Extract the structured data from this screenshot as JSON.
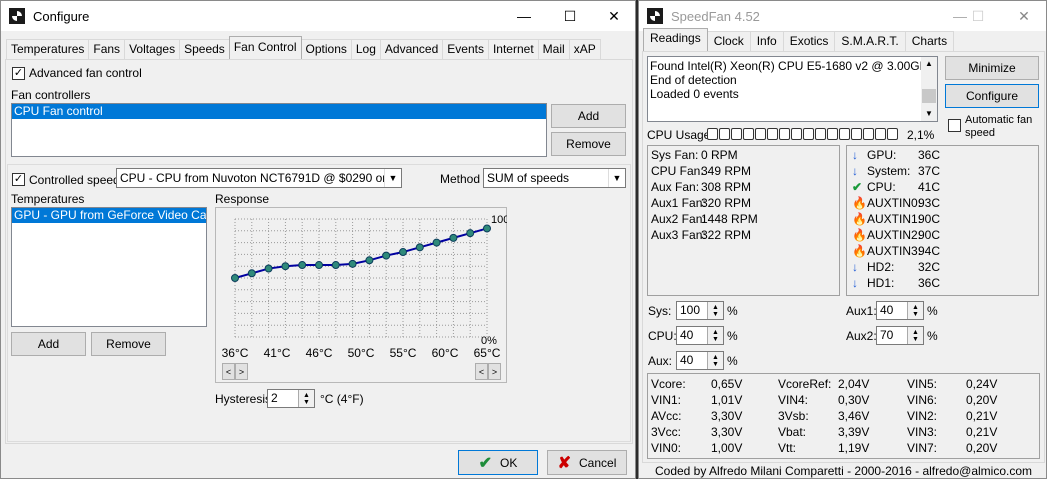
{
  "configure": {
    "title": "Configure",
    "tabs": [
      "Temperatures",
      "Fans",
      "Voltages",
      "Speeds",
      "Fan Control",
      "Options",
      "Log",
      "Advanced",
      "Events",
      "Internet",
      "Mail",
      "xAP"
    ],
    "active_tab": "Fan Control",
    "advanced_fan_control": "Advanced fan control",
    "fan_controllers_label": "Fan controllers",
    "fan_controllers_items": [
      "CPU Fan control"
    ],
    "add": "Add",
    "remove": "Remove",
    "controlled_speed_label": "Controlled speed",
    "controlled_speed_value": "CPU - CPU from Nuvoton NCT6791D @ $0290 on ISA",
    "method_label": "Method",
    "method_value": "SUM of speeds",
    "temperatures_label": "Temperatures",
    "temperatures_items": [
      "GPU - GPU from GeForce Video Card @"
    ],
    "temp_add": "Add",
    "temp_remove": "Remove",
    "response_label": "Response",
    "response_top": "100%",
    "response_bottom": "0%",
    "response_x_ticks": [
      "36°C",
      "41°C",
      "46°C",
      "50°C",
      "55°C",
      "60°C",
      "65°C"
    ],
    "response_points": [
      0.5,
      0.54,
      0.58,
      0.6,
      0.61,
      0.61,
      0.61,
      0.62,
      0.65,
      0.69,
      0.72,
      0.76,
      0.8,
      0.84,
      0.88,
      0.92
    ],
    "hysteresis_label": "Hysteresis",
    "hysteresis_value": "2",
    "hysteresis_unit": "°C (4°F)",
    "ok": "OK",
    "cancel": "Cancel"
  },
  "speedfan": {
    "title": "SpeedFan 4.52",
    "tabs": [
      "Readings",
      "Clock",
      "Info",
      "Exotics",
      "S.M.A.R.T.",
      "Charts"
    ],
    "active_tab": "Readings",
    "log_lines": [
      "Found Intel(R) Xeon(R) CPU E5-1680 v2 @ 3.00GHz",
      "End of detection",
      "Loaded 0 events"
    ],
    "minimize": "Minimize",
    "configure": "Configure",
    "auto_fan_speed": "Automatic fan speed",
    "cpu_usage_label": "CPU Usage",
    "cpu_usage_value": "2,1%",
    "cpu_usage_cells": 16,
    "fans": [
      {
        "label": "Sys Fan:",
        "value": "0 RPM"
      },
      {
        "label": "CPU Fan:",
        "value": "349 RPM"
      },
      {
        "label": "Aux Fan:",
        "value": "308 RPM"
      },
      {
        "label": "Aux1 Fan:",
        "value": "320 RPM"
      },
      {
        "label": "Aux2 Fan:",
        "value": "1448 RPM"
      },
      {
        "label": "Aux3 Fan:",
        "value": "322 RPM"
      }
    ],
    "temps": [
      {
        "label": "GPU:",
        "value": "36C",
        "icon": "arrow-down"
      },
      {
        "label": "System:",
        "value": "37C",
        "icon": "arrow-down"
      },
      {
        "label": "CPU:",
        "value": "41C",
        "icon": "check"
      },
      {
        "label": "AUXTIN0:",
        "value": "93C",
        "icon": "fire"
      },
      {
        "label": "AUXTIN1:",
        "value": "90C",
        "icon": "fire"
      },
      {
        "label": "AUXTIN2:",
        "value": "90C",
        "icon": "fire"
      },
      {
        "label": "AUXTIN3:",
        "value": "94C",
        "icon": "fire"
      },
      {
        "label": "HD2:",
        "value": "32C",
        "icon": "arrow-down"
      },
      {
        "label": "HD1:",
        "value": "36C",
        "icon": "arrow-down"
      }
    ],
    "speeds_left": [
      {
        "label": "Sys:",
        "value": "100"
      },
      {
        "label": "CPU:",
        "value": "40"
      },
      {
        "label": "Aux:",
        "value": "40"
      }
    ],
    "speeds_right": [
      {
        "label": "Aux1:",
        "value": "40"
      },
      {
        "label": "Aux2:",
        "value": "70"
      }
    ],
    "percent": "%",
    "voltages": [
      [
        {
          "label": "Vcore:",
          "value": "0,65V"
        },
        {
          "label": "VcoreRef:",
          "value": "2,04V"
        },
        {
          "label": "VIN5:",
          "value": "0,24V"
        }
      ],
      [
        {
          "label": "VIN1:",
          "value": "1,01V"
        },
        {
          "label": "VIN4:",
          "value": "0,30V"
        },
        {
          "label": "VIN6:",
          "value": "0,20V"
        }
      ],
      [
        {
          "label": "AVcc:",
          "value": "3,30V"
        },
        {
          "label": "3Vsb:",
          "value": "3,46V"
        },
        {
          "label": "VIN2:",
          "value": "0,21V"
        }
      ],
      [
        {
          "label": "3Vcc:",
          "value": "3,30V"
        },
        {
          "label": "Vbat:",
          "value": "3,39V"
        },
        {
          "label": "VIN3:",
          "value": "0,21V"
        }
      ],
      [
        {
          "label": "VIN0:",
          "value": "1,00V"
        },
        {
          "label": "Vtt:",
          "value": "1,19V"
        },
        {
          "label": "VIN7:",
          "value": "0,20V"
        }
      ]
    ],
    "footer": "Coded by Alfredo Milani Comparetti - 2000-2016 - alfredo@almico.com"
  }
}
